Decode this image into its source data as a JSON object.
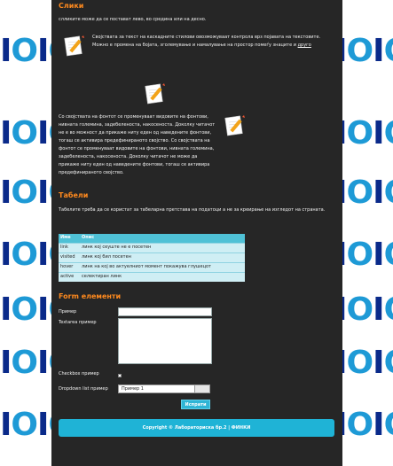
{
  "sections": {
    "images": {
      "title": "Слики",
      "intro": "слликите може да се постават лево, во средина или на десно.",
      "p1": "Својствата за текст на каскадните стилови овозможуваат контрола врз појавата на текстовите. Можно е промена на бојата, зголемување и намалување на простор помеѓу знаците и",
      "p1_link": "друго",
      "p2": "Со својствата на фонтот се променуваат видовите на фонтови, нивната големина, задебеленоста, накосеноста. Доколку читачот не е во можност да прикаже ниту еден од наведените фонтови, тогаш се активира предефинираното својство. Со својствата на фонтот се променуваат видовите на фонтови, нивната големина, задебеленоста, накосеноста. Доколку читачот не може да прикаже ниту еден од наведените фонтови, тогаш се активира предефинираното својство."
    },
    "tables": {
      "title": "Табели",
      "intro": "Табелите треба да се користат за табеларна претстава на податоци а не за креирање на изгледот на страната.",
      "headers": [
        "Име",
        "Опис"
      ],
      "rows": [
        [
          "link",
          "линк кој сеуште не е посетен"
        ],
        [
          "visited",
          "линк кој бил посетен"
        ],
        [
          "hover",
          "линк на кој во актуелниот момент покажува глушецот"
        ],
        [
          "active",
          "селектиран линк"
        ]
      ]
    },
    "form": {
      "title": "Form елементи",
      "text_label": "Пример",
      "textarea_label": "Textarea пример",
      "checkbox_label": "Checkbox пример",
      "dropdown_label": "Dropdown list пример",
      "dropdown_value": "Пример 1",
      "submit_label": "Испрати"
    }
  },
  "footer": {
    "text": "Copyright © Лабораториска бр.2 | ФИНКИ"
  },
  "background_pattern": "IOIOIO",
  "colors": {
    "accent": "#ff8a1e",
    "panel": "#262626",
    "cyan": "#1fb3d6"
  }
}
